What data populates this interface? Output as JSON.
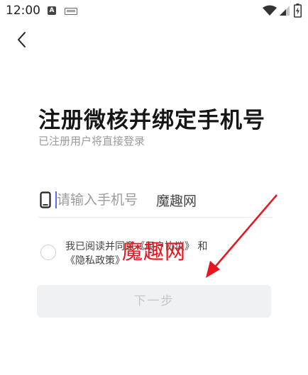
{
  "status_bar": {
    "time": "12:00",
    "icons": [
      "a-notification-icon",
      "keyboard-icon",
      "wifi-icon",
      "signal-icon",
      "battery-icon"
    ]
  },
  "header": {
    "back_icon": "chevron-left-icon"
  },
  "main": {
    "title": "注册微核并绑定手机号",
    "subtitle": "已注册用户将直接登录",
    "phone_input": {
      "placeholder": "请输入手机号",
      "value": "",
      "icon": "phone-icon",
      "overlay_text": "魔趣网"
    },
    "agreement": {
      "prefix": "我已阅读并同意",
      "user_agreement": "《用户协议》",
      "and": "和",
      "privacy_policy": "《隐私政策》"
    },
    "watermark": "魔趣网",
    "next_button": "下一步"
  },
  "colors": {
    "accent_caret": "#5b6bff",
    "watermark_red": "#e8141e",
    "button_bg_disabled": "#f0f1f3",
    "button_text_disabled": "#c4c6ca"
  }
}
